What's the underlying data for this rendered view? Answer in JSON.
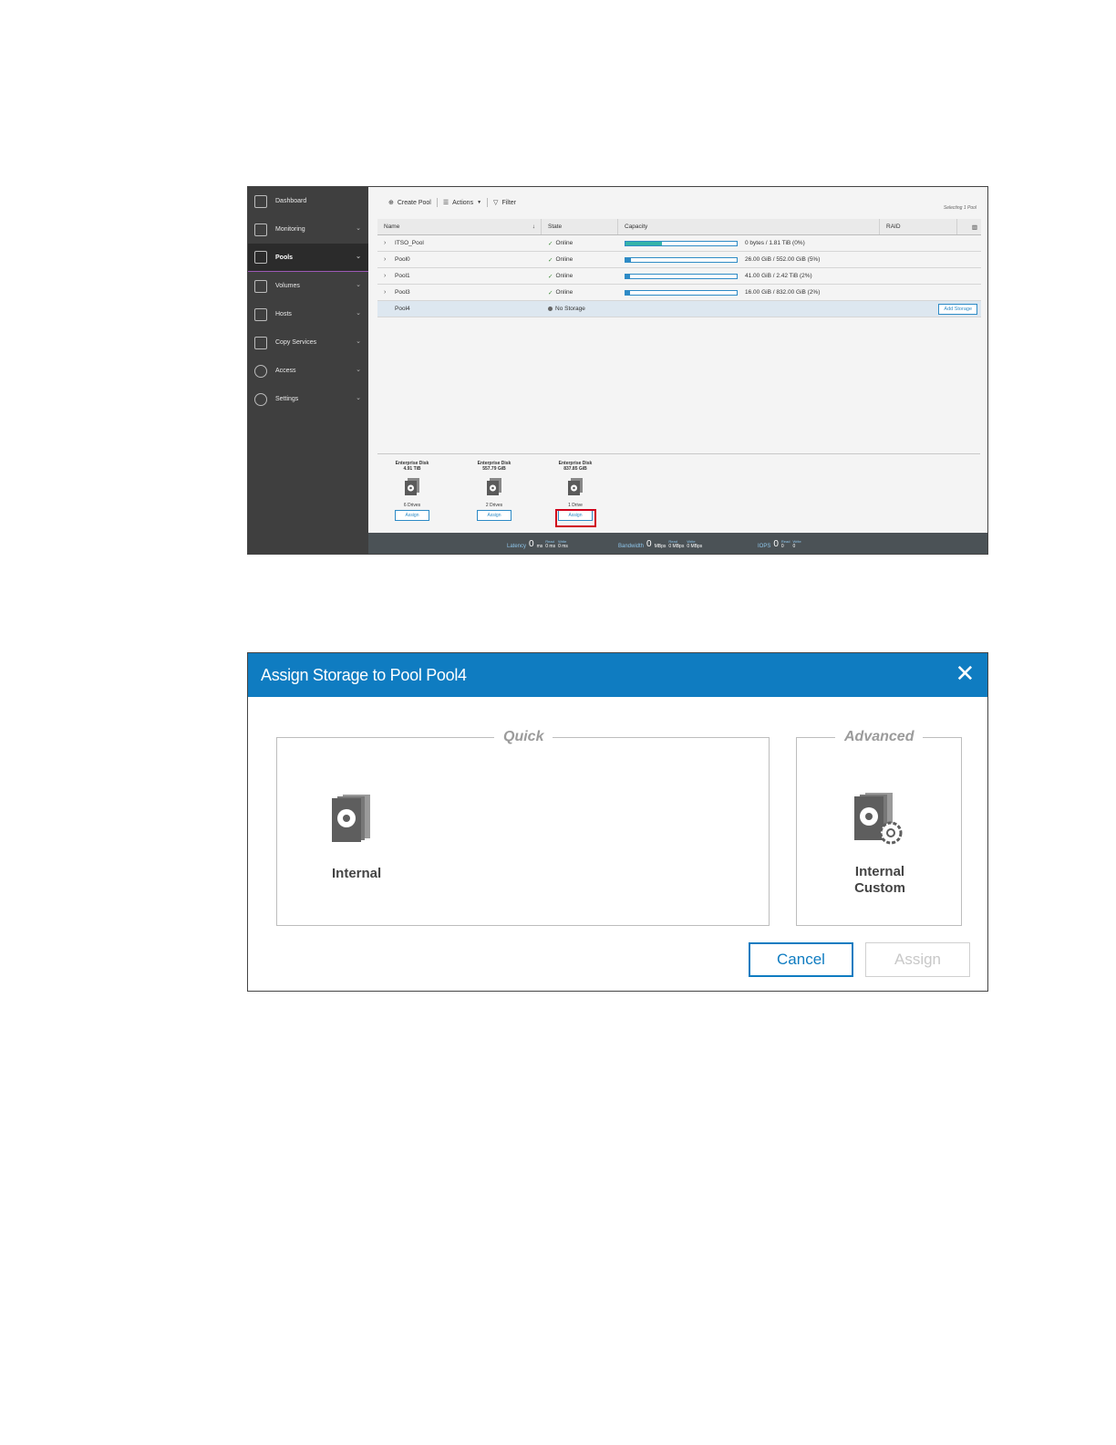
{
  "nav": {
    "items": [
      {
        "label": "Dashboard",
        "icon": "home-icon"
      },
      {
        "label": "Monitoring",
        "icon": "monitoring-icon"
      },
      {
        "label": "Pools",
        "icon": "pools-icon"
      },
      {
        "label": "Volumes",
        "icon": "volumes-icon"
      },
      {
        "label": "Hosts",
        "icon": "hosts-icon"
      },
      {
        "label": "Copy Services",
        "icon": "copy-services-icon"
      },
      {
        "label": "Access",
        "icon": "access-icon"
      },
      {
        "label": "Settings",
        "icon": "settings-icon"
      }
    ],
    "active": "Pools"
  },
  "toolbar": {
    "create_pool": "Create Pool",
    "actions": "Actions",
    "filter": "Filter",
    "selecting": "Selecting 1 Pool"
  },
  "table": {
    "headers": {
      "name": "Name",
      "state": "State",
      "capacity": "Capacity",
      "raid": "RAID"
    },
    "rows": [
      {
        "name": "ITSO_Pool",
        "state": "Online",
        "capacity": "0 bytes / 1.81 TiB (0%)",
        "fill_pct": 33
      },
      {
        "name": "Pool0",
        "state": "Online",
        "capacity": "26.00 GiB / 552.00 GiB (5%)",
        "fill_pct": 5
      },
      {
        "name": "Pool1",
        "state": "Online",
        "capacity": "41.00 GiB / 2.42 TiB (2%)",
        "fill_pct": 2
      },
      {
        "name": "Pool3",
        "state": "Online",
        "capacity": "16.00 GiB / 832.00 GiB (2%)",
        "fill_pct": 2
      },
      {
        "name": "Pool4",
        "state": "No Storage",
        "action": "Add Storage"
      }
    ]
  },
  "disks": [
    {
      "title": "Enterprise Disk",
      "size": "4.91 TiB",
      "drives": "6 Drives",
      "assign": "Assign"
    },
    {
      "title": "Enterprise Disk",
      "size": "557.79 GiB",
      "drives": "2 Drives",
      "assign": "Assign"
    },
    {
      "title": "Enterprise Disk",
      "size": "837.85 GiB",
      "drives": "1 Drive",
      "assign": "Assign"
    }
  ],
  "status": {
    "latency_label": "Latency",
    "latency_value": "0",
    "latency_unit": "ms",
    "latency_read": "0 ms",
    "latency_write": "0 ms",
    "bandwidth_label": "Bandwidth",
    "bandwidth_value": "0",
    "bandwidth_unit": "MBps",
    "bandwidth_read": "0 MBps",
    "bandwidth_write": "0 MBps",
    "iops_label": "IOPS",
    "iops_value": "0",
    "iops_read": "0",
    "iops_write": "0",
    "read_label": "Read",
    "write_label": "Write"
  },
  "dialog": {
    "title": "Assign Storage to Pool Pool4",
    "quick_legend": "Quick",
    "advanced_legend": "Advanced",
    "internal_label": "Internal",
    "internal_custom_line1": "Internal",
    "internal_custom_line2": "Custom",
    "cancel": "Cancel",
    "assign": "Assign"
  },
  "colors": {
    "header_blue": "#0f7cc1",
    "highlight_red": "#d0021b",
    "online_green": "#3d8b37"
  }
}
